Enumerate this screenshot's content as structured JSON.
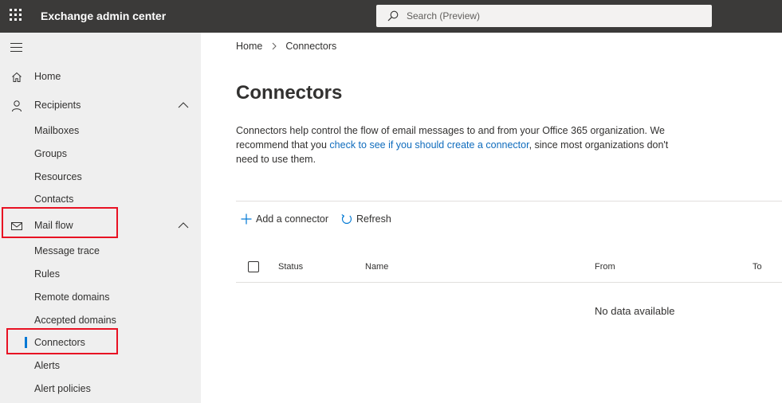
{
  "app": {
    "title": "Exchange admin center"
  },
  "search": {
    "placeholder": "Search (Preview)"
  },
  "icons": {
    "waffle": "waffle-icon",
    "search": "search-icon",
    "hamburger": "hamburger-icon",
    "home": "home-icon",
    "recipients": "person-icon",
    "mail_flow": "mail-icon",
    "chevron": "chevron-up-icon",
    "add": "plus-icon",
    "refresh": "refresh-icon",
    "breadcrumb_sep": "chevron-right-icon"
  },
  "colors": {
    "topbar": "#3b3a39",
    "sidebar": "#efefef",
    "accent": "#0078d4",
    "link": "#0f6cbd",
    "highlight": "#e81123"
  },
  "sidebar": {
    "home": "Home",
    "recipients": {
      "label": "Recipients",
      "items": [
        "Mailboxes",
        "Groups",
        "Resources",
        "Contacts"
      ]
    },
    "mail_flow": {
      "label": "Mail flow",
      "items": [
        "Message trace",
        "Rules",
        "Remote domains",
        "Accepted domains",
        "Connectors",
        "Alerts",
        "Alert policies"
      ],
      "selected": "Connectors"
    }
  },
  "breadcrumb": {
    "home": "Home",
    "current": "Connectors"
  },
  "page": {
    "title": "Connectors",
    "description_pre": "Connectors help control the flow of email messages to and from your Office 365 organization. We recommend that you ",
    "description_link": "check to see if you should create a connector",
    "description_post": ", since most organizations don't need to use them."
  },
  "commands": {
    "add": "Add a connector",
    "refresh": "Refresh"
  },
  "table": {
    "columns": [
      "Status",
      "Name",
      "From",
      "To"
    ],
    "empty_message": "No data available"
  }
}
